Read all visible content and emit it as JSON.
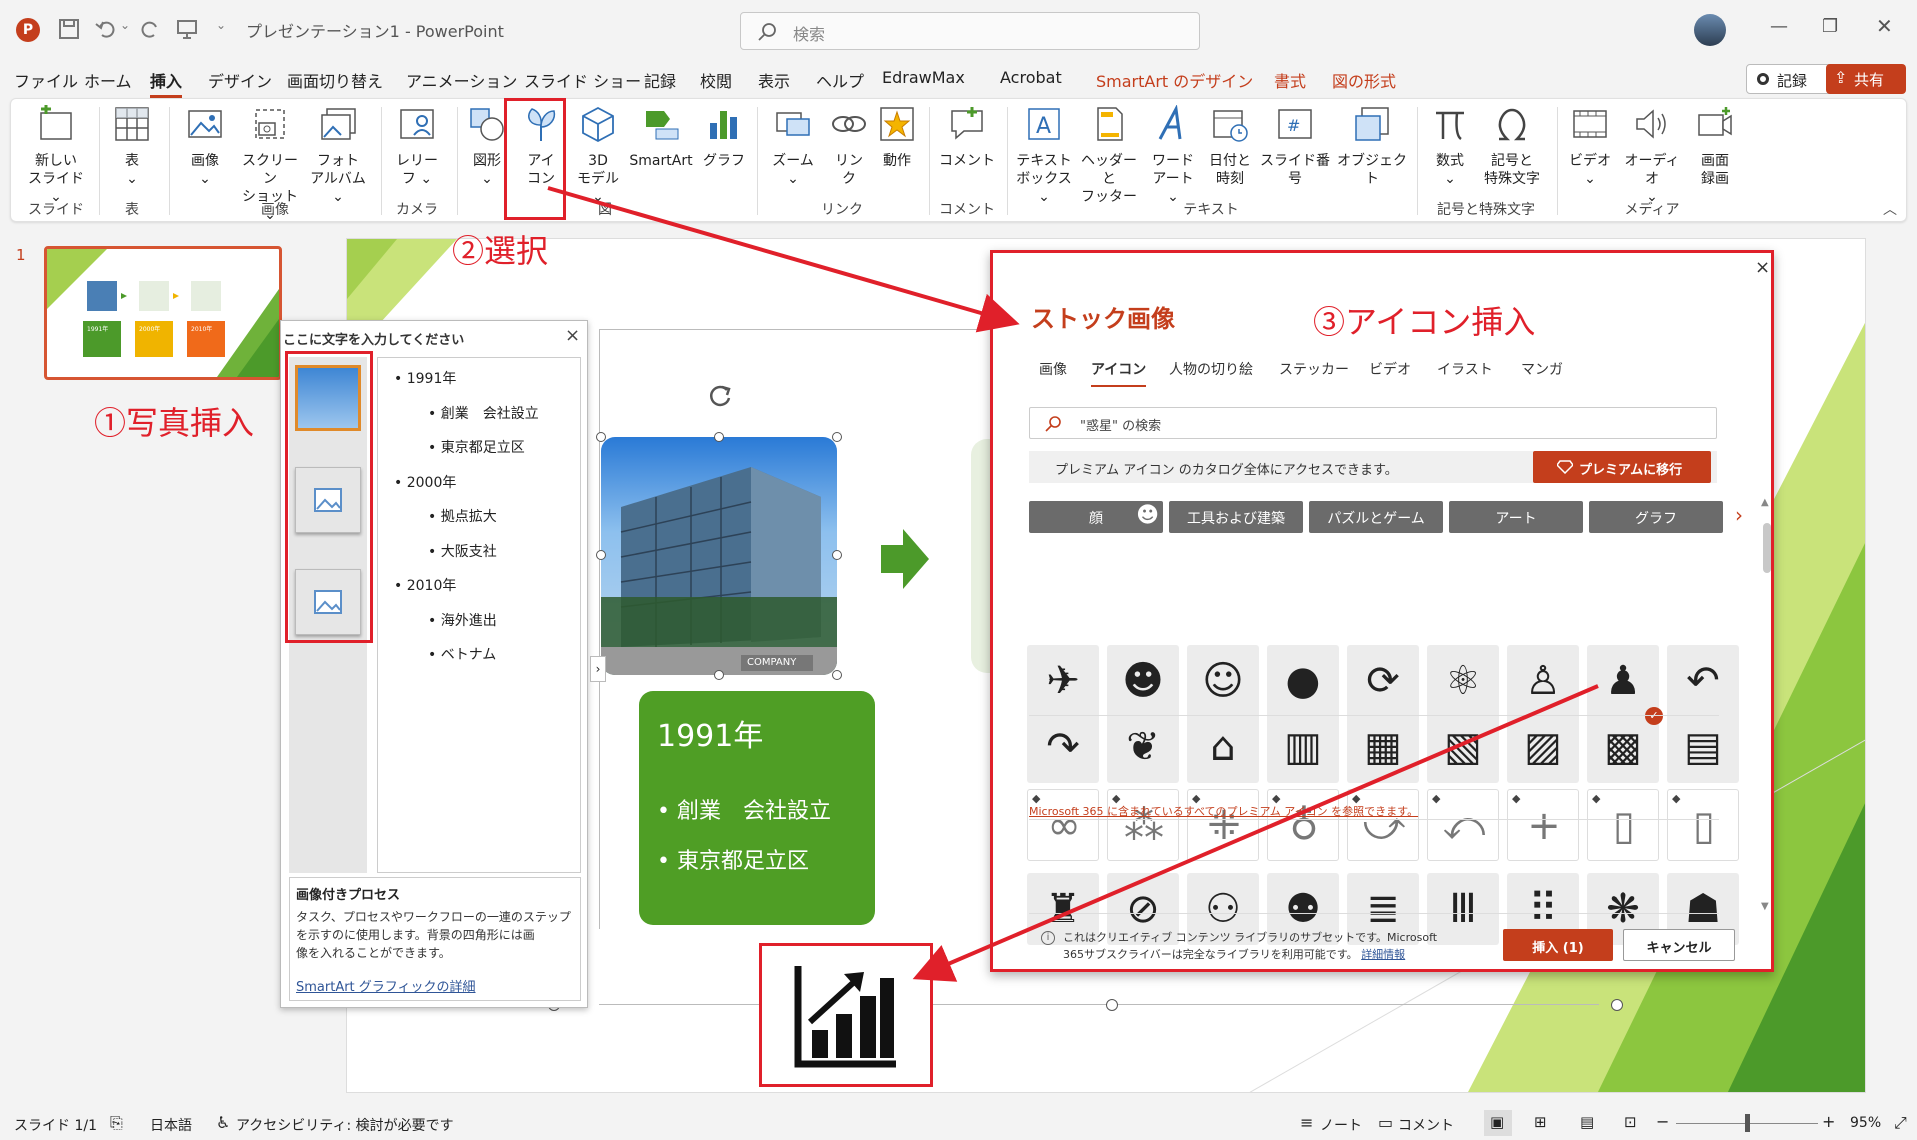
{
  "app": {
    "document_title": "プレゼンテーション1  -  PowerPoint",
    "search_placeholder": "検索",
    "accent": "#c43e1c"
  },
  "tabs": [
    "ファイル",
    "ホーム",
    "挿入",
    "デザイン",
    "画面切り替え",
    "アニメーション",
    "スライド ショー",
    "記録",
    "校閲",
    "表示",
    "ヘルプ",
    "EdrawMax",
    "Acrobat",
    "SmartArt のデザイン",
    "書式",
    "図の形式"
  ],
  "active_tab": "挿入",
  "record_label": "記録",
  "share_label": "共有",
  "ribbon": {
    "slide": {
      "new_slide_1": "新しい",
      "new_slide_2": "スライド ⌄",
      "group": "スライド"
    },
    "table": {
      "table": "表",
      "chev": "⌄",
      "group": "表"
    },
    "images": {
      "image": "画像",
      "chev": "⌄",
      "screenshot_1": "スクリーン",
      "screenshot_2": "ショット ⌄",
      "album_1": "フォト",
      "album_2": "アルバム ⌄",
      "group": "画像"
    },
    "camera": {
      "cameo_1": "レリー",
      "cameo_2": "フ ⌄",
      "group": "カメラ"
    },
    "illust": {
      "shapes": "図形",
      "shapes_chev": "⌄",
      "icons_1": "アイ",
      "icons_2": "コン",
      "models_1": "3D",
      "models_2": "モデル ⌄",
      "smartart": "SmartArt",
      "chart": "グラフ",
      "group": "図"
    },
    "links": {
      "zoom": "ズーム",
      "zoom_chev": "⌄",
      "link_1": "リン",
      "link_2": "ク",
      "action": "動作",
      "group": "リンク"
    },
    "comments": {
      "comment": "コメント",
      "group": "コメント"
    },
    "text": {
      "textbox_1": "テキスト",
      "textbox_2": "ボックス ⌄",
      "header_1": "ヘッダーと",
      "header_2": "フッター",
      "wordart_1": "ワード",
      "wordart_2": "アート ⌄",
      "datetime_1": "日付と",
      "datetime_2": "時刻",
      "slidenum": "スライド番号",
      "object": "オブジェクト",
      "group": "テキスト"
    },
    "symbols": {
      "equation": "数式",
      "equation_chev": "⌄",
      "symbol_1": "記号と",
      "symbol_2": "特殊文字",
      "group": "記号と特殊文字"
    },
    "media": {
      "video": "ビデオ",
      "video_chev": "⌄",
      "audio": "オーディオ",
      "audio_chev": "⌄",
      "screenrec_1": "画面",
      "screenrec_2": "録画",
      "group": "メディア"
    }
  },
  "slide_number": "1",
  "thumbnail": {
    "t1": "1991年",
    "t2": "2000年",
    "t3": "2010年"
  },
  "annotations": {
    "step1": "①写真挿入",
    "step2": "②選択",
    "step3": "③アイコン挿入"
  },
  "text_pane": {
    "title": "ここに文字を入力してください",
    "bullets": [
      {
        "level": 1,
        "text": "1991年"
      },
      {
        "level": 2,
        "text": "創業　会社設立"
      },
      {
        "level": 2,
        "text": "東京都足立区"
      },
      {
        "level": 1,
        "text": "2000年"
      },
      {
        "level": 2,
        "text": "拠点拡大"
      },
      {
        "level": 2,
        "text": "大阪支社"
      },
      {
        "level": 1,
        "text": "2010年"
      },
      {
        "level": 2,
        "text": "海外進出"
      },
      {
        "level": 2,
        "text": "ベトナム"
      }
    ],
    "info_title": "画像付きプロセス",
    "info_body_1": "タスク、プロセスやワークフローの一連のステップ",
    "info_body_2": "を示すのに使用します。背景の四角形には画",
    "info_body_3": "像を入れることができます。",
    "info_link": "SmartArt グラフィックの詳細"
  },
  "slide_box": {
    "year": "1991年",
    "items": [
      "創業　会社設立",
      "東京都足立区"
    ],
    "photo_caption": "COMPANY"
  },
  "dialog": {
    "title": "ストック画像",
    "tabs": [
      "画像",
      "アイコン",
      "人物の切り絵",
      "ステッカー",
      "ビデオ",
      "イラスト",
      "マンガ"
    ],
    "active_tab": "アイコン",
    "search_placeholder": "\"惑星\" の検索",
    "premium_text": "プレミアム アイコン のカタログ全体にアクセスできます。",
    "premium_button": "プレミアムに移行",
    "categories": [
      "顔",
      "工具および建築",
      "パズルとゲーム",
      "アート",
      "グラフ"
    ],
    "premium_link": "Microsoft 365 に含まれているすべてのプレミアム アイコン を参照できます。",
    "footer_1": "これはクリエイティブ コンテンツ ライブラリのサブセットです。Microsoft",
    "footer_2": "365サブスクライバーは完全なライブラリを利用可能です。",
    "footer_link": "詳細情報",
    "insert_button": "挿入 (1)",
    "cancel_button": "キャンセル",
    "close": "×"
  },
  "status": {
    "slide": "スライド 1/1",
    "language": "日本語",
    "accessibility": "アクセシビリティ: 検討が必要です",
    "notes": "ノート",
    "comments": "コメント",
    "zoom": "95%",
    "zoom_level": 0.5
  }
}
